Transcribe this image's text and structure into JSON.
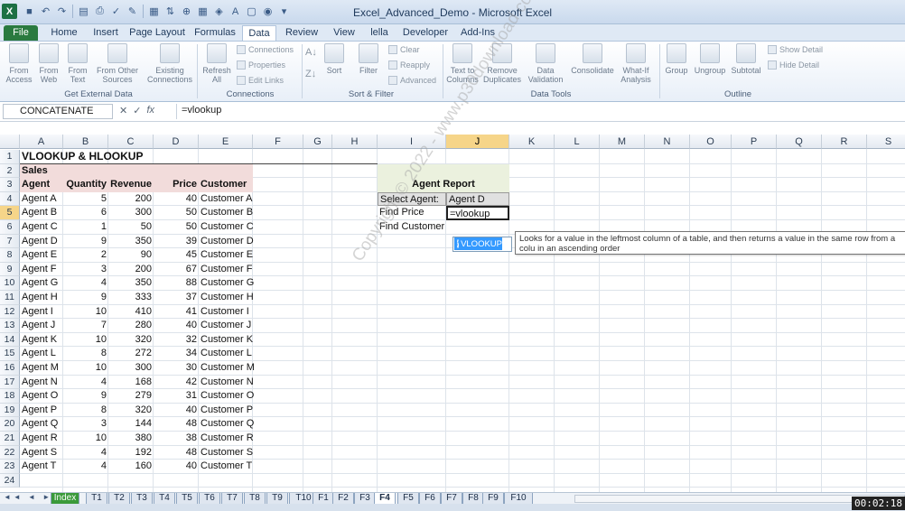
{
  "window": {
    "title": "Excel_Advanced_Demo - Microsoft Excel"
  },
  "ribbon_tabs": [
    "File",
    "Home",
    "Insert",
    "Page Layout",
    "Formulas",
    "Data",
    "Review",
    "View",
    "lella",
    "Developer",
    "Add-Ins"
  ],
  "ribbon": {
    "get_external": {
      "label": "Get External Data",
      "buttons": [
        "From Access",
        "From Web",
        "From Text",
        "From Other Sources",
        "Existing Connections"
      ]
    },
    "connections": {
      "label": "Connections",
      "refresh": "Refresh All",
      "items": [
        "Connections",
        "Properties",
        "Edit Links"
      ]
    },
    "sort_filter": {
      "label": "Sort & Filter",
      "sort": "Sort",
      "filter": "Filter",
      "items": [
        "Clear",
        "Reapply",
        "Advanced"
      ]
    },
    "data_tools": {
      "label": "Data Tools",
      "buttons": [
        "Text to Columns",
        "Remove Duplicates",
        "Data Validation",
        "Consolidate",
        "What-If Analysis"
      ]
    },
    "outline": {
      "label": "Outline",
      "buttons": [
        "Group",
        "Ungroup",
        "Subtotal"
      ],
      "items": [
        "Show Detail",
        "Hide Detail"
      ]
    }
  },
  "formula_bar": {
    "name_box": "CONCATENATE",
    "formula": "=vlookup"
  },
  "columns": [
    "A",
    "B",
    "C",
    "D",
    "E",
    "F",
    "G",
    "H",
    "I",
    "J",
    "K",
    "L",
    "M",
    "N",
    "O",
    "P",
    "Q",
    "R",
    "S"
  ],
  "sheet": {
    "title": "VLOOKUP & HLOOKUP",
    "section": "Sales",
    "headers": [
      "Agent",
      "Quantity",
      "Revenue",
      "Price",
      "Customer"
    ],
    "rows": [
      [
        "Agent A",
        "5",
        "200",
        "40",
        "Customer A"
      ],
      [
        "Agent B",
        "6",
        "300",
        "50",
        "Customer B"
      ],
      [
        "Agent C",
        "1",
        "50",
        "50",
        "Customer C"
      ],
      [
        "Agent D",
        "9",
        "350",
        "39",
        "Customer D"
      ],
      [
        "Agent E",
        "2",
        "90",
        "45",
        "Customer E"
      ],
      [
        "Agent F",
        "3",
        "200",
        "67",
        "Customer F"
      ],
      [
        "Agent G",
        "4",
        "350",
        "88",
        "Customer G"
      ],
      [
        "Agent H",
        "9",
        "333",
        "37",
        "Customer H"
      ],
      [
        "Agent I",
        "10",
        "410",
        "41",
        "Customer I"
      ],
      [
        "Agent J",
        "7",
        "280",
        "40",
        "Customer J"
      ],
      [
        "Agent K",
        "10",
        "320",
        "32",
        "Customer K"
      ],
      [
        "Agent L",
        "8",
        "272",
        "34",
        "Customer L"
      ],
      [
        "Agent M",
        "10",
        "300",
        "30",
        "Customer M"
      ],
      [
        "Agent N",
        "4",
        "168",
        "42",
        "Customer N"
      ],
      [
        "Agent O",
        "9",
        "279",
        "31",
        "Customer O"
      ],
      [
        "Agent P",
        "8",
        "320",
        "40",
        "Customer P"
      ],
      [
        "Agent Q",
        "3",
        "144",
        "48",
        "Customer Q"
      ],
      [
        "Agent R",
        "10",
        "380",
        "38",
        "Customer R"
      ],
      [
        "Agent S",
        "4",
        "192",
        "48",
        "Customer S"
      ],
      [
        "Agent T",
        "4",
        "160",
        "40",
        "Customer T"
      ]
    ],
    "report": {
      "title": "Agent Report",
      "select_label": "Select Agent:",
      "select_value": "Agent D",
      "price_label": "Find Price",
      "price_value": "=vlookup",
      "customer_label": "Find Customer"
    }
  },
  "autocomplete": {
    "item": "VLOOKUP",
    "tooltip": "Looks for a value in the leftmost column of a table, and then returns a value in the same row from a colu in an ascending order"
  },
  "watermark": "Copyright © 2022 - www.p30download.com",
  "sheet_tabs": [
    "Index",
    "T1",
    "T2",
    "T3",
    "T4",
    "T5",
    "T6",
    "T7",
    "T8",
    "T9",
    "T10",
    "F1",
    "F2",
    "F3",
    "F4",
    "F5",
    "F6",
    "F7",
    "F8",
    "F9",
    "F10"
  ],
  "active_sheet": "F4",
  "timer": "00:02:18",
  "colors": {
    "accent_sales": "#f2dcdb",
    "report_title": "#ebf1de",
    "file_tab": "#2a7a3f",
    "select_highlight": "#f6d589"
  }
}
